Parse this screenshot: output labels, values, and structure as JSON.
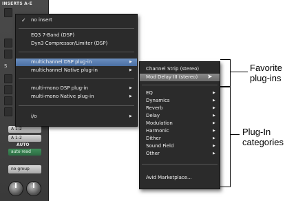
{
  "strip": {
    "header": "INSERTS A-E",
    "slot_s_label": "S",
    "io_buttons": [
      "A 1-2",
      "A 1-2"
    ],
    "automation_label": "AUTO",
    "automation_value": "auto read",
    "group_value": "no group"
  },
  "main_menu": {
    "items": [
      {
        "label": "no insert",
        "checked": "✓"
      },
      {
        "label": "EQ3 7-Band (DSP)"
      },
      {
        "label": "Dyn3 Compressor/Limiter (DSP)"
      },
      {
        "label": "multichannel DSP plug-in",
        "arrow": "▶"
      },
      {
        "label": "multichannel Native plug-in",
        "arrow": "▶"
      },
      {
        "label": "multi-mono DSP plug-in",
        "arrow": "▶"
      },
      {
        "label": "multi-mono Native plug-in",
        "arrow": "▶"
      },
      {
        "label": "i/o",
        "arrow": "▶"
      }
    ]
  },
  "sub_menu": {
    "favorites": [
      "Channel Strip (stereo)",
      "Mod Delay III (stereo)"
    ],
    "categories": [
      "EQ",
      "Dynamics",
      "Reverb",
      "Delay",
      "Modulation",
      "Harmonic",
      "Dither",
      "Sound Field",
      "Other"
    ],
    "arrow": "▶",
    "marketplace": "Avid Marketplace..."
  },
  "callouts": {
    "favorite_line1": "Favorite",
    "favorite_line2": "plug-ins",
    "categories_line1": "Plug-In",
    "categories_line2": "categories"
  },
  "colors": {
    "highlight_main": "#5a7fb4",
    "highlight_sub": "#7a7a7a",
    "menu_bg": "#2b2b2b"
  }
}
